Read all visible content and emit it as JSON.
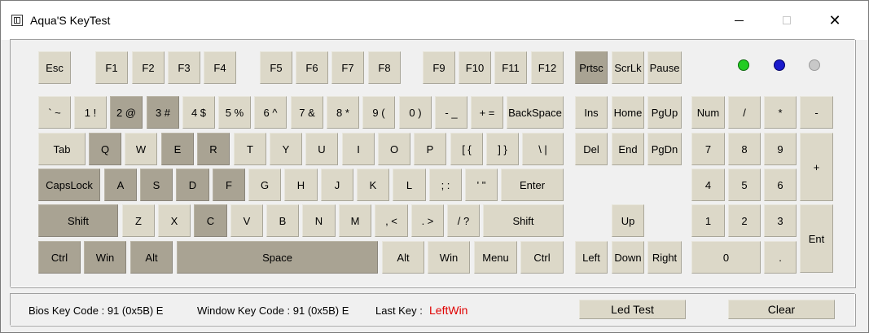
{
  "window": {
    "title": "Aqua'S KeyTest",
    "controls": {
      "minimize": "",
      "maximize": "",
      "close": "✕"
    }
  },
  "keys": [
    {
      "id": "esc",
      "label": "Esc",
      "pressed": false
    },
    {
      "id": "f1",
      "label": "F1",
      "pressed": false
    },
    {
      "id": "f2",
      "label": "F2",
      "pressed": false
    },
    {
      "id": "f3",
      "label": "F3",
      "pressed": false
    },
    {
      "id": "f4",
      "label": "F4",
      "pressed": false
    },
    {
      "id": "f5",
      "label": "F5",
      "pressed": false
    },
    {
      "id": "f6",
      "label": "F6",
      "pressed": false
    },
    {
      "id": "f7",
      "label": "F7",
      "pressed": false
    },
    {
      "id": "f8",
      "label": "F8",
      "pressed": false
    },
    {
      "id": "f9",
      "label": "F9",
      "pressed": false
    },
    {
      "id": "f10",
      "label": "F10",
      "pressed": false
    },
    {
      "id": "f11",
      "label": "F11",
      "pressed": false
    },
    {
      "id": "f12",
      "label": "F12",
      "pressed": false
    },
    {
      "id": "prtsc",
      "label": "Prtsc",
      "pressed": true
    },
    {
      "id": "scrlk",
      "label": "ScrLk",
      "pressed": false
    },
    {
      "id": "pause",
      "label": "Pause",
      "pressed": false
    },
    {
      "id": "backtick",
      "label": "` ~",
      "pressed": false
    },
    {
      "id": "d1",
      "label": "1 !",
      "pressed": false
    },
    {
      "id": "d2",
      "label": "2 @",
      "pressed": true
    },
    {
      "id": "d3",
      "label": "3 #",
      "pressed": true
    },
    {
      "id": "d4",
      "label": "4 $",
      "pressed": false
    },
    {
      "id": "d5",
      "label": "5 %",
      "pressed": false
    },
    {
      "id": "d6",
      "label": "6 ^",
      "pressed": false
    },
    {
      "id": "d7",
      "label": "7 &",
      "pressed": false
    },
    {
      "id": "d8",
      "label": "8 *",
      "pressed": false
    },
    {
      "id": "d9",
      "label": "9 (",
      "pressed": false
    },
    {
      "id": "d0",
      "label": "0 )",
      "pressed": false
    },
    {
      "id": "minus",
      "label": "- _",
      "pressed": false
    },
    {
      "id": "equals",
      "label": "+ =",
      "pressed": false
    },
    {
      "id": "backspace",
      "label": "BackSpace",
      "pressed": false
    },
    {
      "id": "ins",
      "label": "Ins",
      "pressed": false
    },
    {
      "id": "home",
      "label": "Home",
      "pressed": false
    },
    {
      "id": "pgup",
      "label": "PgUp",
      "pressed": false
    },
    {
      "id": "num",
      "label": "Num",
      "pressed": false
    },
    {
      "id": "np-slash",
      "label": "/",
      "pressed": false
    },
    {
      "id": "np-star",
      "label": "*",
      "pressed": false
    },
    {
      "id": "np-minus",
      "label": "-",
      "pressed": false
    },
    {
      "id": "tab",
      "label": "Tab",
      "pressed": false
    },
    {
      "id": "q",
      "label": "Q",
      "pressed": true
    },
    {
      "id": "w",
      "label": "W",
      "pressed": false
    },
    {
      "id": "e",
      "label": "E",
      "pressed": true
    },
    {
      "id": "r",
      "label": "R",
      "pressed": true
    },
    {
      "id": "t",
      "label": "T",
      "pressed": false
    },
    {
      "id": "y",
      "label": "Y",
      "pressed": false
    },
    {
      "id": "u",
      "label": "U",
      "pressed": false
    },
    {
      "id": "i",
      "label": "I",
      "pressed": false
    },
    {
      "id": "o",
      "label": "O",
      "pressed": false
    },
    {
      "id": "p",
      "label": "P",
      "pressed": false
    },
    {
      "id": "lbracket",
      "label": "[ {",
      "pressed": false
    },
    {
      "id": "rbracket",
      "label": "] }",
      "pressed": false
    },
    {
      "id": "backslash",
      "label": "\\ |",
      "pressed": false
    },
    {
      "id": "del",
      "label": "Del",
      "pressed": false
    },
    {
      "id": "end",
      "label": "End",
      "pressed": false
    },
    {
      "id": "pgdn",
      "label": "PgDn",
      "pressed": false
    },
    {
      "id": "np7",
      "label": "7",
      "pressed": false
    },
    {
      "id": "np8",
      "label": "8",
      "pressed": false
    },
    {
      "id": "np9",
      "label": "9",
      "pressed": false
    },
    {
      "id": "np-plus",
      "label": "+",
      "pressed": false
    },
    {
      "id": "capslock",
      "label": "CapsLock",
      "pressed": true
    },
    {
      "id": "a",
      "label": "A",
      "pressed": true
    },
    {
      "id": "s",
      "label": "S",
      "pressed": true
    },
    {
      "id": "d",
      "label": "D",
      "pressed": true
    },
    {
      "id": "f",
      "label": "F",
      "pressed": true
    },
    {
      "id": "g",
      "label": "G",
      "pressed": false
    },
    {
      "id": "h",
      "label": "H",
      "pressed": false
    },
    {
      "id": "j",
      "label": "J",
      "pressed": false
    },
    {
      "id": "k",
      "label": "K",
      "pressed": false
    },
    {
      "id": "l",
      "label": "L",
      "pressed": false
    },
    {
      "id": "semicolon",
      "label": "; :",
      "pressed": false
    },
    {
      "id": "quote",
      "label": "' \"",
      "pressed": false
    },
    {
      "id": "enter",
      "label": "Enter",
      "pressed": false
    },
    {
      "id": "np4",
      "label": "4",
      "pressed": false
    },
    {
      "id": "np5",
      "label": "5",
      "pressed": false
    },
    {
      "id": "np6",
      "label": "6",
      "pressed": false
    },
    {
      "id": "lshift",
      "label": "Shift",
      "pressed": true
    },
    {
      "id": "z",
      "label": "Z",
      "pressed": false
    },
    {
      "id": "x",
      "label": "X",
      "pressed": false
    },
    {
      "id": "c",
      "label": "C",
      "pressed": true
    },
    {
      "id": "v",
      "label": "V",
      "pressed": false
    },
    {
      "id": "b",
      "label": "B",
      "pressed": false
    },
    {
      "id": "n",
      "label": "N",
      "pressed": false
    },
    {
      "id": "m",
      "label": "M",
      "pressed": false
    },
    {
      "id": "comma",
      "label": ", <",
      "pressed": false
    },
    {
      "id": "period",
      "label": ". >",
      "pressed": false
    },
    {
      "id": "slash",
      "label": "/ ?",
      "pressed": false
    },
    {
      "id": "rshift",
      "label": "Shift",
      "pressed": false
    },
    {
      "id": "up",
      "label": "Up",
      "pressed": false
    },
    {
      "id": "np1",
      "label": "1",
      "pressed": false
    },
    {
      "id": "np2",
      "label": "2",
      "pressed": false
    },
    {
      "id": "np3",
      "label": "3",
      "pressed": false
    },
    {
      "id": "np-enter",
      "label": "Ent",
      "pressed": false
    },
    {
      "id": "lctrl",
      "label": "Ctrl",
      "pressed": true
    },
    {
      "id": "lwin",
      "label": "Win",
      "pressed": true
    },
    {
      "id": "lalt",
      "label": "Alt",
      "pressed": true
    },
    {
      "id": "space",
      "label": "Space",
      "pressed": true
    },
    {
      "id": "ralt",
      "label": "Alt",
      "pressed": false
    },
    {
      "id": "rwin",
      "label": "Win",
      "pressed": false
    },
    {
      "id": "menu",
      "label": "Menu",
      "pressed": false
    },
    {
      "id": "rctrl",
      "label": "Ctrl",
      "pressed": false
    },
    {
      "id": "left",
      "label": "Left",
      "pressed": false
    },
    {
      "id": "down",
      "label": "Down",
      "pressed": false
    },
    {
      "id": "right",
      "label": "Right",
      "pressed": false
    },
    {
      "id": "np0",
      "label": "0",
      "pressed": false
    },
    {
      "id": "np-dot",
      "label": ".",
      "pressed": false
    }
  ],
  "leds": [
    {
      "id": "num-lock-led",
      "color": "#22cc22",
      "border": "#0a6a0a"
    },
    {
      "id": "caps-lock-led",
      "color": "#1a1acc",
      "border": "#000066"
    },
    {
      "id": "scroll-lock-led",
      "color": "#c8c8c8",
      "border": "#9a9a9a"
    }
  ],
  "status": {
    "bios_label": "Bios Key Code : 91 (0x5B) E",
    "window_label": "Window Key Code : 91 (0x5B) E",
    "last_key_label": "Last Key :",
    "last_key_value": "LeftWin",
    "led_test_button": "Led Test",
    "clear_button": "Clear"
  }
}
